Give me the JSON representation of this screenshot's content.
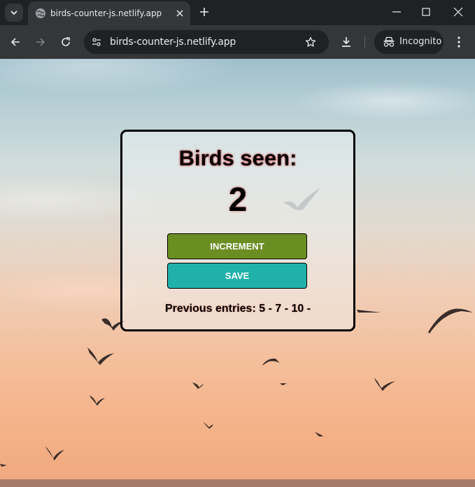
{
  "browser": {
    "tab_title": "birds-counter-js.netlify.app",
    "url": "birds-counter-js.netlify.app",
    "profile_label": "Incognito"
  },
  "app": {
    "title": "Birds seen:",
    "count": "2",
    "increment_label": "INCREMENT",
    "save_label": "SAVE",
    "entries_text": "Previous entries: 5 - 7 - 10 -"
  },
  "colors": {
    "increment_button": "#6b8e23",
    "save_button": "#20b2aa"
  }
}
